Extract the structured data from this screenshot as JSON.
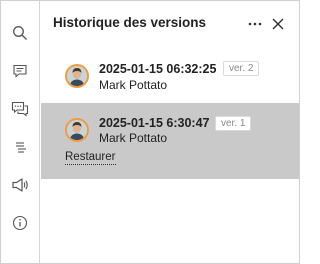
{
  "header": {
    "title": "Historique des versions",
    "more_icon": "more-horizontal-icon",
    "close_icon": "close-icon"
  },
  "rail": {
    "items": [
      {
        "icon": "search-icon"
      },
      {
        "icon": "comment-icon"
      },
      {
        "icon": "chat-icon"
      },
      {
        "icon": "align-text-icon"
      },
      {
        "icon": "megaphone-icon"
      },
      {
        "icon": "info-icon"
      }
    ]
  },
  "versions": [
    {
      "date": "2025-01-15 06:32:25",
      "author": "Mark Pottato",
      "badge": "ver. 2",
      "selected": false
    },
    {
      "date": "2025-01-15 6:30:47",
      "author": "Mark Pottato",
      "badge": "ver. 1",
      "selected": true,
      "restore_label": "Restaurer"
    }
  ],
  "colors": {
    "selected_row": "#c9c9c9",
    "avatar_ring": "#f39a3a"
  }
}
